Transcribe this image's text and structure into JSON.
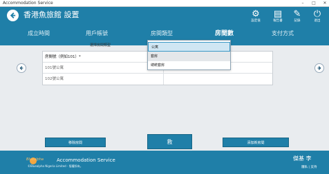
{
  "window": {
    "title": "Accommodation Service",
    "minimize": "–",
    "maximize": "□",
    "close": "✕"
  },
  "header": {
    "title": "香港魚旅館 設置",
    "tools": [
      {
        "label": "設定值",
        "icon": "gear-icon",
        "glyph": "⚙"
      },
      {
        "label": "報告書",
        "icon": "report-icon",
        "glyph": "▤"
      },
      {
        "label": "記錄",
        "icon": "log-icon",
        "glyph": "✎"
      },
      {
        "label": "退出",
        "icon": "power-icon",
        "glyph": "⏻"
      }
    ]
  },
  "tabs": [
    {
      "label": "成立時間"
    },
    {
      "label": "用戶帳號"
    },
    {
      "label": "房間類型"
    },
    {
      "label": "房間數"
    },
    {
      "label": "支付方式"
    }
  ],
  "main": {
    "subtitle": "選擇房間類型",
    "column_header": "房間號（例如101）*",
    "rows": [
      "101號公寓",
      "102號公寓"
    ]
  },
  "dropdown": {
    "options": [
      "公寓",
      "套房",
      "總統套房"
    ],
    "selected": "公寓"
  },
  "buttons": {
    "delete": "移除房間",
    "save": "救",
    "add": "添加新房間"
  },
  "footer": {
    "brand": "Bluealpha",
    "service": "Accommodation Service",
    "copyright": "©Bluealpha Nigeria Limited - 版權所有。",
    "user": "傑基 李",
    "links": "隱私 | 支持"
  },
  "colors": {
    "primary": "#1f7fa8",
    "background": "#e9ecef",
    "accent": "#f3a640"
  }
}
